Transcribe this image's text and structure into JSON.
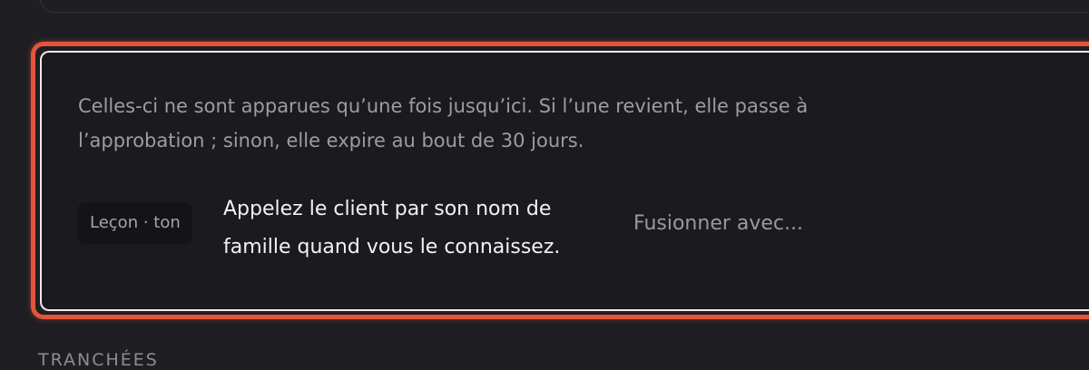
{
  "review_card": {
    "intro": "Celles-ci ne sont apparues qu’une fois jusqu’ici. Si l’une revient, elle passe à l’approbation ; sinon, elle expire au bout de 30 jours.",
    "candidate": {
      "tag": "Leçon · ton",
      "text": "Appelez le client par son nom de famille quand vous le connaissez.",
      "merge_label": "Fusionner avec..."
    },
    "highlight_color": "#e2553b"
  },
  "next_section": {
    "title": "Tranchées"
  }
}
